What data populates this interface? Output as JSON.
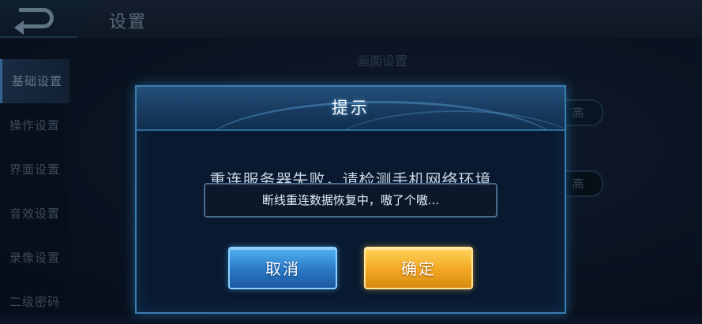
{
  "header": {
    "title": "设置"
  },
  "sidebar": {
    "items": [
      {
        "label": "基础设置",
        "active": true
      },
      {
        "label": "操作设置"
      },
      {
        "label": "界面设置"
      },
      {
        "label": "音效设置"
      },
      {
        "label": "录像设置"
      },
      {
        "label": "二级密码"
      }
    ]
  },
  "background": {
    "section_title": "画面设置",
    "option_high": "高"
  },
  "dialog": {
    "title": "提示",
    "message": "重连服务器失败，请检测手机网络环境",
    "cancel_label": "取消",
    "confirm_label": "确定"
  },
  "toast": {
    "text": "断线重连数据恢复中，嗷了个嗷..."
  },
  "colors": {
    "accent_blue": "#3a7eb0",
    "cancel_button": "#2a78c4",
    "confirm_button": "#f1a722"
  },
  "icons": {
    "back": "back-arrow-icon"
  }
}
